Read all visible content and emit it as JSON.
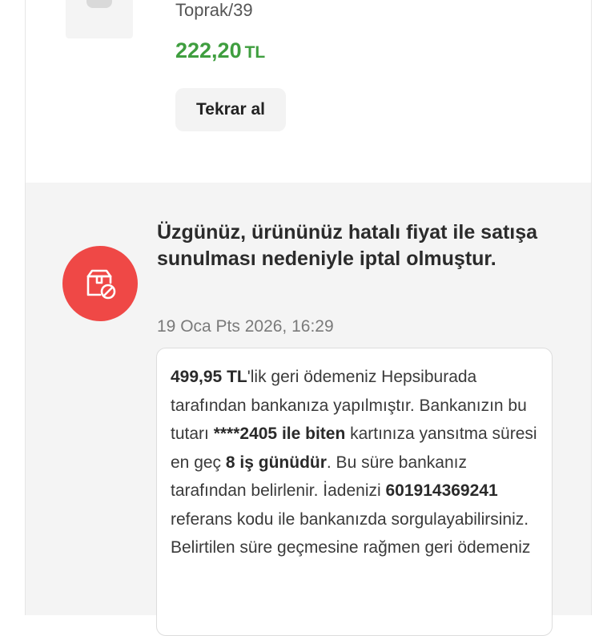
{
  "product": {
    "variant": "Toprak/39",
    "price_amount": "222,20",
    "price_currency": "TL",
    "rebuy_label": "Tekrar al"
  },
  "cancellation": {
    "icon": "box-cancel-icon",
    "badge_color": "#ef4846",
    "title": "Üzgünüz, ürününüz hatalı fiyat ile satışa sunulması nedeniyle iptal olmuştur.",
    "date": "19 Oca Pts 2026, 16:29",
    "message": {
      "refund_amount": "499,95 TL",
      "part1": "'lik geri ödemeniz Hepsiburada tarafından bankanıza yapılmıştır. Bankanızın bu tutarı ",
      "card_suffix": "****2405 ile biten",
      "part2": " kartınıza yansıtma süresi en geç ",
      "duration": "8 iş günüdür",
      "part3": ". Bu süre bankanız tarafından belirlenir. İadenizi ",
      "reference_code": "601914369241",
      "part4": " referans kodu ile bankanızda sorgulayabilirsiniz. Belirtilen süre geçmesine rağmen geri ödemeniz"
    }
  },
  "colors": {
    "price_green": "#3f9e3f",
    "section_bg": "#f4f4f4"
  }
}
